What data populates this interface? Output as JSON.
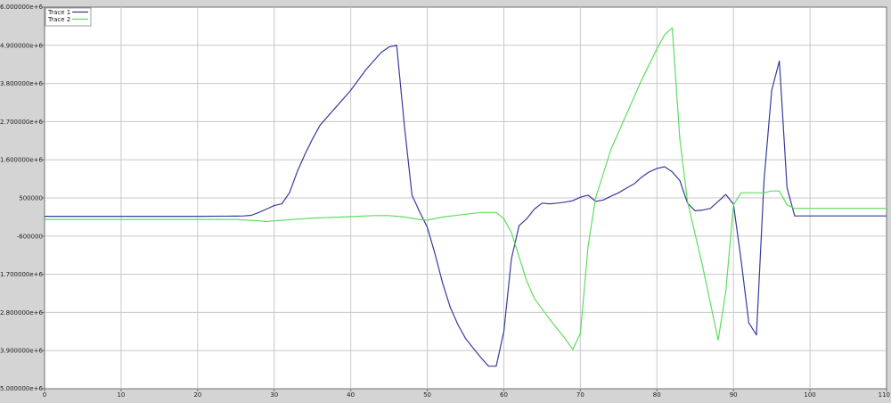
{
  "chart_data": {
    "type": "line",
    "title": "",
    "xlabel": "",
    "ylabel": "",
    "xlim": [
      0,
      110
    ],
    "ylim": [
      -5000000,
      6000000
    ],
    "grid": true,
    "legend_position": "top-left",
    "x_ticks": [
      0,
      10,
      20,
      30,
      40,
      50,
      60,
      70,
      80,
      90,
      100,
      110
    ],
    "x_tick_labels": [
      "0",
      "10",
      "20",
      "30",
      "40",
      "50",
      "60",
      "70",
      "80",
      "90",
      "100",
      "110"
    ],
    "y_ticks": [
      -5000000,
      -3900000,
      -2800000,
      -1700000,
      -600000,
      500000,
      1600000,
      2700000,
      3800000,
      4900000,
      6000000
    ],
    "y_tick_labels": [
      "-5.000000e+6",
      "-3.900000e+6",
      "-2.800000e+6",
      "-1.700000e+6",
      "-600000",
      "500000",
      "1.600000e+6",
      "2.700000e+6",
      "3.800000e+6",
      "4.900000e+6",
      "6.000000e+6"
    ],
    "series": [
      {
        "name": "Trace 1",
        "color": "#3a3a9e",
        "x": [
          0,
          10,
          20,
          25,
          26,
          27,
          28,
          29,
          30,
          31,
          32,
          33,
          34,
          35,
          36,
          38,
          40,
          42,
          44,
          45,
          46,
          47,
          48,
          49,
          50,
          51,
          52,
          53,
          54,
          55,
          56,
          57,
          58,
          59,
          60,
          61,
          62,
          63,
          64,
          65,
          66,
          67,
          68,
          69,
          70,
          71,
          72,
          73,
          74,
          75,
          76,
          77,
          78,
          79,
          80,
          81,
          82,
          83,
          84,
          85,
          86,
          87,
          88,
          89,
          90,
          91,
          92,
          93,
          94,
          95,
          96,
          97,
          98,
          99,
          100,
          110
        ],
        "values": [
          -30000,
          -30000,
          -30000,
          -25000,
          -20000,
          0,
          80000,
          180000,
          280000,
          330000,
          650000,
          1250000,
          1750000,
          2200000,
          2600000,
          3100000,
          3600000,
          4200000,
          4700000,
          4850000,
          4900000,
          2600000,
          580000,
          100000,
          -340000,
          -1100000,
          -1950000,
          -2650000,
          -3150000,
          -3550000,
          -3830000,
          -4100000,
          -4350000,
          -4350000,
          -3350000,
          -1250000,
          -300000,
          -100000,
          180000,
          350000,
          330000,
          350000,
          380000,
          420000,
          520000,
          580000,
          400000,
          440000,
          550000,
          650000,
          780000,
          900000,
          1100000,
          1250000,
          1350000,
          1400000,
          1250000,
          1000000,
          350000,
          130000,
          150000,
          200000,
          400000,
          600000,
          320000,
          -1300000,
          -3100000,
          -3450000,
          1000000,
          3600000,
          4450000,
          800000,
          -20000,
          -20000,
          -20000,
          -20000
        ]
      },
      {
        "name": "Trace 2",
        "color": "#5fdc5f",
        "x": [
          0,
          10,
          20,
          25,
          28,
          29,
          30,
          35,
          40,
          43,
          45,
          47,
          49,
          50,
          52,
          55,
          57,
          59,
          60,
          61,
          62,
          63,
          64,
          66,
          68,
          69,
          70,
          71,
          72,
          74,
          76,
          78,
          80,
          81,
          82,
          83,
          84,
          86,
          88,
          89,
          90,
          91,
          92,
          93,
          94,
          95,
          96,
          97,
          98,
          100,
          110
        ],
        "values": [
          -120000,
          -120000,
          -120000,
          -120000,
          -160000,
          -180000,
          -160000,
          -80000,
          -40000,
          -10000,
          -10000,
          -50000,
          -120000,
          -140000,
          -50000,
          30000,
          80000,
          80000,
          -100000,
          -500000,
          -1200000,
          -1900000,
          -2400000,
          -3000000,
          -3550000,
          -3870000,
          -3400000,
          -900000,
          500000,
          1900000,
          2900000,
          3900000,
          4800000,
          5200000,
          5400000,
          2200000,
          400000,
          -1500000,
          -3600000,
          -2200000,
          300000,
          650000,
          650000,
          650000,
          650000,
          700000,
          700000,
          300000,
          200000,
          200000,
          200000
        ]
      }
    ]
  }
}
